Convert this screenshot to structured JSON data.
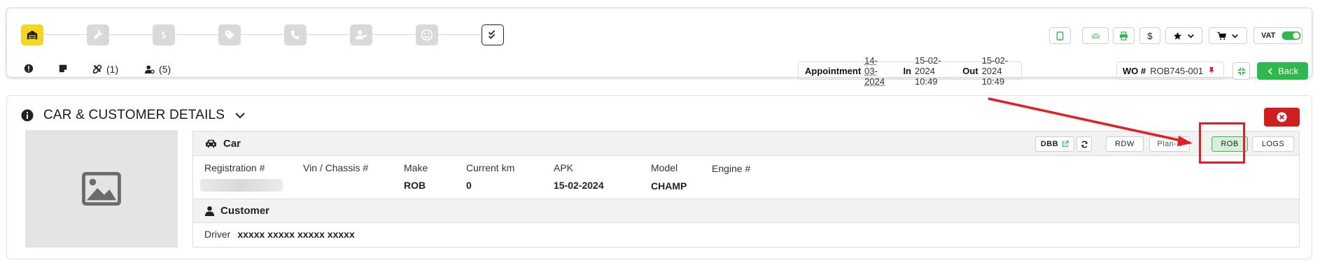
{
  "stepper": {
    "steps": [
      {
        "name": "garage",
        "icon": "garage-icon"
      },
      {
        "name": "repair",
        "icon": "wrench-icon"
      },
      {
        "name": "pricing",
        "icon": "dollar-icon"
      },
      {
        "name": "tags",
        "icon": "tag-icon"
      },
      {
        "name": "call",
        "icon": "phone-icon"
      },
      {
        "name": "approval",
        "icon": "user-check-icon"
      },
      {
        "name": "customer-satisfaction",
        "icon": "smiley-icon"
      },
      {
        "name": "done",
        "icon": "double-check-icon"
      }
    ]
  },
  "sections": {
    "repairs_count": "(1)",
    "customers_count": "(5)"
  },
  "toolbar": {
    "dollar": "$",
    "vat_label": "VAT"
  },
  "info": {
    "appointment_label": "Appointment",
    "appointment_value": "14-03-2024",
    "in_label": "In",
    "in_value": "15-02-2024 10:49",
    "out_label": "Out",
    "out_value": "15-02-2024 10:49",
    "wo_label": "WO #",
    "wo_value": "ROB745-001",
    "back_label": "Back"
  },
  "details": {
    "title": "CAR & CUSTOMER DETAILS",
    "car_heading": "Car",
    "buttons": {
      "dbb": "DBB",
      "rdw": "RDW",
      "planit": "Plan-It",
      "rob": "ROB",
      "logs": "LOGS"
    },
    "fields": [
      {
        "label": "Registration #",
        "value": ""
      },
      {
        "label": "Vin / Chassis #",
        "value": ""
      },
      {
        "label": "Make",
        "value": "ROB"
      },
      {
        "label": "Current km",
        "value": "0"
      },
      {
        "label": "APK",
        "value": "15-02-2024"
      },
      {
        "label": "Model",
        "value": "CHAMP"
      },
      {
        "label": "Engine #",
        "value": ""
      }
    ],
    "customer_heading": "Customer",
    "driver_label": "Driver",
    "driver_value": "xxxxx xxxxx xxxxx xxxxx"
  },
  "colors": {
    "active_step": "#f5d620",
    "back_button": "#2eb84d",
    "close_button": "#cf1f1f",
    "rob_button_bg": "#d4f0d8",
    "annotation": "#e01f26"
  }
}
